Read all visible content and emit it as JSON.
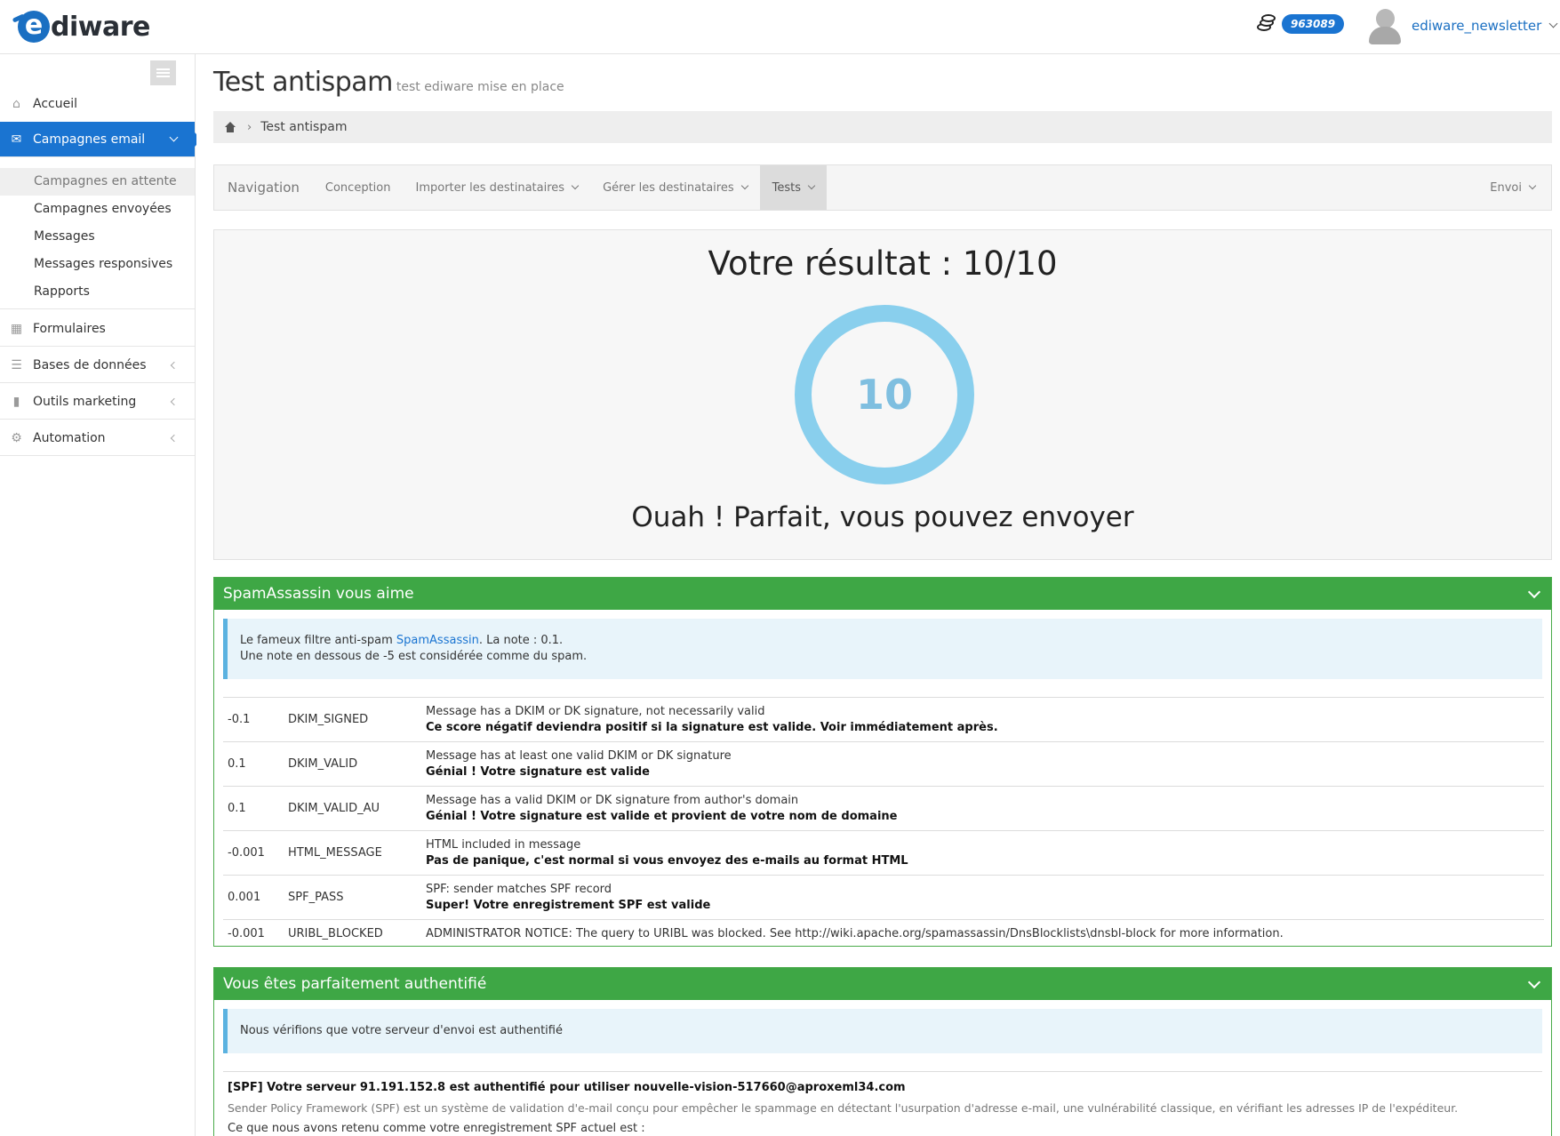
{
  "header": {
    "logo_text": "diware",
    "logo_letter": "e",
    "credits": "963089",
    "user_name": "ediware_newsletter"
  },
  "sidebar": {
    "items": [
      {
        "label": "Accueil",
        "icon": "home-icon"
      },
      {
        "label": "Campagnes email",
        "icon": "envelope-icon"
      },
      {
        "label": "Formulaires",
        "icon": "table-icon"
      },
      {
        "label": "Bases de données",
        "icon": "list-icon"
      },
      {
        "label": "Outils marketing",
        "icon": "video-camera-icon"
      },
      {
        "label": "Automation",
        "icon": "cogs-icon"
      }
    ],
    "sub_items": [
      "Campagnes en attente",
      "Campagnes envoyées",
      "Messages",
      "Messages responsives",
      "Rapports"
    ]
  },
  "page": {
    "title": "Test antispam",
    "subtitle": "test ediware mise en place",
    "breadcrumb": "Test antispam"
  },
  "tabs": {
    "brand": "Navigation",
    "items": [
      "Conception",
      "Importer les destinataires",
      "Gérer les destinataires",
      "Tests"
    ],
    "right": "Envoi"
  },
  "score": {
    "title": "Votre résultat : 10/10",
    "value": "10",
    "message": "Ouah ! Parfait, vous pouvez envoyer"
  },
  "spamassassin": {
    "heading": "SpamAssassin vous aime",
    "info_prefix": "Le fameux filtre anti-spam ",
    "info_link": "SpamAssassin",
    "info_suffix": ". La note : 0.1.",
    "info_line2": "Une note en dessous de -5 est considérée comme du spam.",
    "rules": [
      {
        "score": "-0.1",
        "name": "DKIM_SIGNED",
        "desc": "Message has a DKIM or DK signature, not necessarily valid",
        "note": "Ce score négatif deviendra positif si la signature est valide. Voir immédiatement après."
      },
      {
        "score": "0.1",
        "name": "DKIM_VALID",
        "desc": "Message has at least one valid DKIM or DK signature",
        "note": "Génial ! Votre signature est valide"
      },
      {
        "score": "0.1",
        "name": "DKIM_VALID_AU",
        "desc": "Message has a valid DKIM or DK signature from author's domain",
        "note": "Génial ! Votre signature est valide et provient de votre nom de domaine"
      },
      {
        "score": "-0.001",
        "name": "HTML_MESSAGE",
        "desc": "HTML included in message",
        "note": "Pas de panique, c'est normal si vous envoyez des e-mails au format HTML"
      },
      {
        "score": "0.001",
        "name": "SPF_PASS",
        "desc": "SPF: sender matches SPF record",
        "note": "Super! Votre enregistrement SPF est valide"
      },
      {
        "score": "-0.001",
        "name": "URIBL_BLOCKED",
        "desc": "ADMINISTRATOR NOTICE: The query to URIBL was blocked. See http://wiki.apache.org/spamassassin/DnsBlocklists\\dnsbl-block for more information.",
        "note": ""
      }
    ]
  },
  "auth": {
    "heading": "Vous êtes parfaitement authentifié",
    "info": "Nous vérifions que votre serveur d'envoi est authentifié",
    "spf_title": "[SPF] Votre serveur 91.191.152.8 est authentifié pour utiliser nouvelle-vision-517660@aproxeml34.com",
    "spf_desc": "Sender Policy Framework (SPF) est un système de validation d'e-mail conçu pour empêcher le spammage en détectant l'usurpation d'adresse e-mail, une vulnérabilité classique, en vérifiant les adresses IP de l'expéditeur.",
    "spf_record_label": "Ce que nous avons retenu comme votre enregistrement SPF actuel est :"
  },
  "colors": {
    "brand_blue": "#1a74d1",
    "panel_green": "#3ea745",
    "ring_blue": "#89cfed"
  }
}
